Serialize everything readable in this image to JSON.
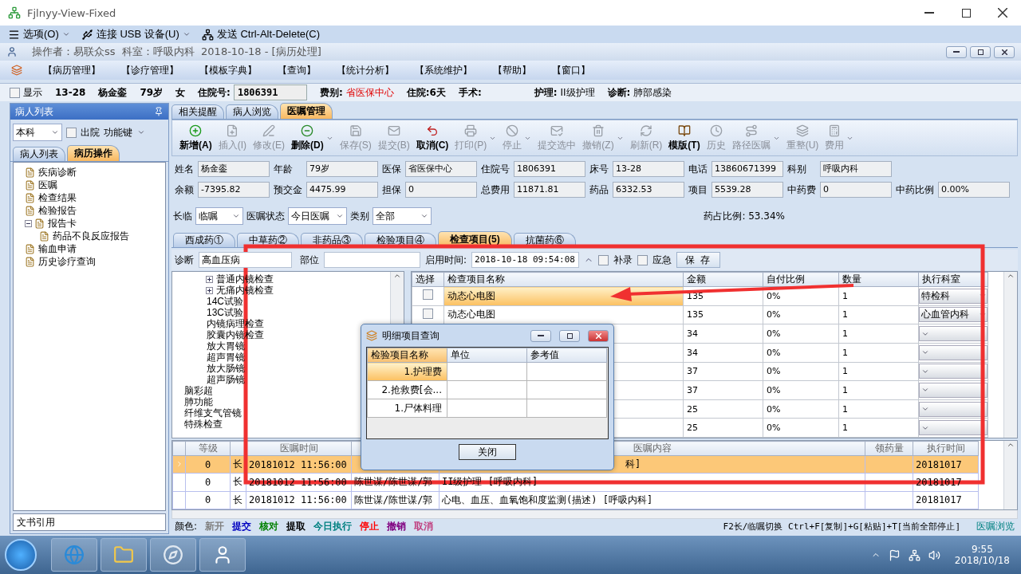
{
  "window": {
    "title": "Fjlnyy-View-Fixed"
  },
  "remote_toolbar": [
    {
      "label": "选项(O)",
      "dropdown": true
    },
    {
      "label": "连接 USB 设备(U)",
      "dropdown": true
    },
    {
      "label": "发送 Ctrl-Alt-Delete(C)",
      "dropdown": false
    }
  ],
  "app_title": "操作者：易联众ss  科室：呼吸内科  2018-10-18 - [病历处理]",
  "menu": [
    "【病历管理】",
    "【诊疗管理】",
    "【模板字典】",
    "【查询】",
    "【统计分析】",
    "【系统维护】",
    "【帮助】",
    "【窗口】"
  ],
  "patient_bar": {
    "show": {
      "label": "显示",
      "checked": false
    },
    "bed": "13-28",
    "name": "杨金銮",
    "age": "79岁",
    "sex": "女",
    "admission_label": "住院号:",
    "admission_no": "1806391",
    "fee_label": "费别:",
    "fee": "省医保中心",
    "stay": "住院:6天",
    "surgery": "手术:",
    "nursing_label": "护理:",
    "nursing": "II级护理",
    "diagnosis_label": "诊断:",
    "diagnosis": "肺部感染"
  },
  "left_panel": {
    "title": "病人列表",
    "dept_select": "本科",
    "discharged": {
      "label": "出院",
      "checked": false
    },
    "function_key": "功能键",
    "tabs": [
      {
        "label": "病人列表",
        "selected": false
      },
      {
        "label": "病历操作",
        "selected": true
      }
    ],
    "tree": [
      {
        "label": "疾病诊断"
      },
      {
        "label": "医嘱"
      },
      {
        "label": "检查结果"
      },
      {
        "label": "检验报告"
      },
      {
        "label": "报告卡",
        "expanded": true,
        "children": [
          {
            "label": "药品不良反应报告"
          }
        ]
      },
      {
        "label": "输血申请"
      },
      {
        "label": "历史诊疗查询"
      }
    ],
    "footer": "文书引用"
  },
  "top_tabs": [
    {
      "label": "相关提醒",
      "selected": false
    },
    {
      "label": "病人浏览",
      "selected": false
    },
    {
      "label": "医嘱管理",
      "selected": true
    }
  ],
  "toolbar": [
    {
      "label": "新增(A)",
      "disabled": false,
      "dropdown": false
    },
    {
      "label": "插入(I)",
      "disabled": true,
      "dropdown": false
    },
    {
      "label": "修改(E)",
      "disabled": true,
      "dropdown": false
    },
    {
      "label": "删除(D)",
      "disabled": false,
      "dropdown": true
    },
    {
      "label": "保存(S)",
      "disabled": true,
      "dropdown": false
    },
    {
      "label": "提交(B)",
      "disabled": true,
      "dropdown": false
    },
    {
      "label": "取消(C)",
      "disabled": false,
      "dropdown": false
    },
    {
      "label": "打印(P)",
      "disabled": true,
      "dropdown": true
    },
    {
      "label": "停止",
      "disabled": true,
      "dropdown": true
    },
    {
      "label": "提交选中",
      "disabled": true,
      "dropdown": false
    },
    {
      "label": "撤销(Z)",
      "disabled": true,
      "dropdown": true
    },
    {
      "label": "刷新(R)",
      "disabled": true,
      "dropdown": false
    },
    {
      "label": "模版(T)",
      "disabled": false,
      "dropdown": false
    },
    {
      "label": "历史",
      "disabled": true,
      "dropdown": false
    },
    {
      "label": "路径医嘱",
      "disabled": true,
      "dropdown": true
    },
    {
      "label": "重整(U)",
      "disabled": true,
      "dropdown": false
    },
    {
      "label": "费用",
      "disabled": true,
      "dropdown": true
    }
  ],
  "info_rows": [
    [
      {
        "label": "姓名",
        "value": "杨金銮"
      },
      {
        "label": "年龄",
        "value": "79岁"
      },
      {
        "label": "医保",
        "value": "省医保中心"
      },
      {
        "label": "住院号",
        "value": "1806391"
      },
      {
        "label": "床号",
        "value": "13-28"
      },
      {
        "label": "电话",
        "value": "13860671399"
      },
      {
        "label": "科别",
        "value": "呼吸内科"
      }
    ],
    [
      {
        "label": "余额",
        "value": "-7395.82"
      },
      {
        "label": "预交金",
        "value": "4475.99"
      },
      {
        "label": "担保",
        "value": "0"
      },
      {
        "label": "总费用",
        "value": "11871.81"
      },
      {
        "label": "药品",
        "value": "6332.53"
      },
      {
        "label": "项目",
        "value": "5539.28"
      },
      {
        "label": "中药费",
        "value": "0"
      },
      {
        "label": "中药比例",
        "value": "0.00%"
      }
    ]
  ],
  "filters": [
    {
      "label": "长临",
      "value": "临嘱"
    },
    {
      "label": "医嘱状态",
      "value": "今日医嘱"
    },
    {
      "label": "类别",
      "value": "全部"
    }
  ],
  "drug_ratio": "药占比例: 53.34%",
  "sub_tabs": [
    {
      "label": "西成药①",
      "selected": false
    },
    {
      "label": "中草药②",
      "selected": false
    },
    {
      "label": "非药品③",
      "selected": false
    },
    {
      "label": "检验项目④",
      "selected": false
    },
    {
      "label": "检查项目(5)",
      "selected": true
    },
    {
      "label": "抗菌药⑥",
      "selected": false
    }
  ],
  "exam_form": {
    "diagnosis_label": "诊断",
    "diagnosis": "高血压病",
    "site_label": "部位",
    "start_label": "启用时间:",
    "start_time": "2018-10-18 09:54:08",
    "supplement": {
      "label": "补录",
      "checked": false
    },
    "emergency": {
      "label": "应急",
      "checked": false
    },
    "save": "保 存"
  },
  "exam_tree": [
    {
      "children": [
        {
          "label": "普通内镜检查",
          "expanded": false
        },
        {
          "label": "无痛内镜检查",
          "expanded": false
        },
        {
          "label": "14C试验"
        },
        {
          "label": "13C试验"
        },
        {
          "label": "内镜病理检查"
        },
        {
          "label": "胶囊内镜检查"
        },
        {
          "label": "放大胃镜"
        },
        {
          "label": "超声胃镜"
        },
        {
          "label": "放大肠镜"
        },
        {
          "label": "超声肠镜"
        }
      ]
    },
    {
      "label": "脑彩超"
    },
    {
      "label": "肺功能"
    },
    {
      "label": "纤维支气管镜"
    },
    {
      "label": "特殊检查"
    }
  ],
  "exam_table": {
    "columns": [
      "选择",
      "检查项目名称",
      "金额",
      "自付比例",
      "数量",
      "执行科室"
    ],
    "rows": [
      {
        "checked": false,
        "selected": true,
        "name": "动态心电图",
        "amount": "135",
        "ratio": "0%",
        "qty": "1",
        "dept": "特检科"
      },
      {
        "checked": false,
        "selected": false,
        "name": "动态心电图",
        "amount": "135",
        "ratio": "0%",
        "qty": "1",
        "dept": "心血管内科"
      },
      {
        "selected": false,
        "amount": "34",
        "ratio": "0%",
        "qty": "1"
      },
      {
        "selected": false,
        "amount": "34",
        "ratio": "0%",
        "qty": "1"
      },
      {
        "selected": false,
        "amount": "37",
        "ratio": "0%",
        "qty": "1"
      },
      {
        "selected": false,
        "amount": "37",
        "ratio": "0%",
        "qty": "1"
      },
      {
        "selected": false,
        "amount": "25",
        "ratio": "0%",
        "qty": "1"
      },
      {
        "selected": false,
        "amount": "25",
        "ratio": "0%",
        "qty": "1"
      }
    ]
  },
  "orders": {
    "columns": [
      {
        "label": "等级"
      },
      {},
      {
        "label": "医嘱时间"
      },
      {},
      {
        "label": "医嘱内容"
      },
      {
        "label": "领药量"
      },
      {
        "label": "执行时间"
      }
    ],
    "rows": [
      {
        "selected": true,
        "level": "0",
        "type": "长",
        "time": "20181012 11:56:00",
        "content": "科]",
        "exec_time": "20181017"
      },
      {
        "selected": false,
        "level": "0",
        "type": "长",
        "time": "20181012 11:56:00",
        "doctor": "陈世谋/陈世谋/郭",
        "content": "II级护理    [呼吸内科]",
        "exec_time": "20181017"
      },
      {
        "selected": false,
        "level": "0",
        "type": "长",
        "time": "20181012 11:56:00",
        "doctor": "陈世谋/陈世谋/郭",
        "content": "心电、血压、血氧饱和度监测(描述)    [呼吸内科]",
        "exec_time": "20181017"
      }
    ]
  },
  "legend": {
    "label": "颜色:",
    "items": [
      {
        "label": "新开",
        "color": "#808080"
      },
      {
        "label": "提交",
        "color": "#0000c0"
      },
      {
        "label": "核对",
        "color": "#008000"
      },
      {
        "label": "提取",
        "color": "#000000"
      },
      {
        "label": "今日执行",
        "color": "#008080"
      },
      {
        "label": "停止",
        "color": "#ff0000"
      },
      {
        "label": "撤销",
        "color": "#800080"
      },
      {
        "label": "取消",
        "color": "#c04080"
      }
    ]
  },
  "shortcut_hint": "F2长/临嘱切换 Ctrl+F[复制]+G[粘贴]+T[当前全部停止]",
  "status_mode": "医嘱浏览",
  "dialog": {
    "title": "明细项目查询",
    "columns": [
      "检验项目名称",
      "单位",
      "参考值"
    ],
    "rows": [
      {
        "name": "1.护理费",
        "selected": true
      },
      {
        "name": "2.抢救费[会...",
        "selected": false
      },
      {
        "name": "1.尸体料理",
        "selected": false
      }
    ],
    "close": "关闭"
  },
  "taskbar": {
    "time": "9:55",
    "date": "2018/10/18"
  }
}
